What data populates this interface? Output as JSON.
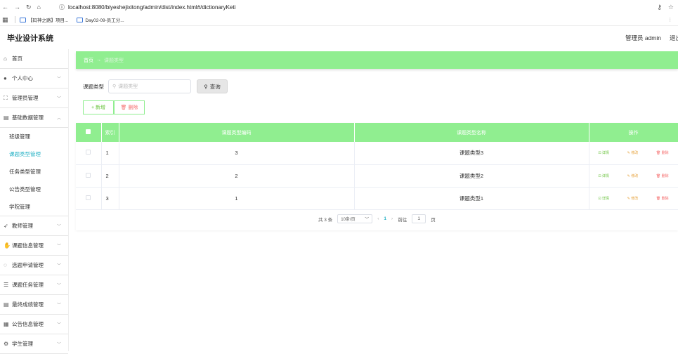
{
  "browser": {
    "url": "localhost:8080/biyeshejixitong/admin/dist/index.html#/dictionaryKeti",
    "bookmarks": [
      "【码神之路】项目...",
      "Day02-09-员工分..."
    ]
  },
  "header": {
    "title": "毕业设计系统",
    "user": "管理员 admin",
    "logout": "退出"
  },
  "sidebar": {
    "items": [
      {
        "label": "首页",
        "icon": "home-icon"
      },
      {
        "label": "个人中心",
        "icon": "person-icon"
      },
      {
        "label": "管理员管理",
        "icon": "frame-icon"
      },
      {
        "label": "基础数据管理",
        "icon": "trash-icon"
      }
    ],
    "subitems": [
      "班级管理",
      "课题类型管理",
      "任务类型管理",
      "公告类型管理",
      "学院管理"
    ],
    "items_after": [
      {
        "label": "教师管理",
        "icon": "send-icon"
      },
      {
        "label": "课题信息管理",
        "icon": "thumb-icon"
      },
      {
        "label": "选题申请管理",
        "icon": "power-icon"
      },
      {
        "label": "课题任务管理",
        "icon": "sliders-icon"
      },
      {
        "label": "最终成绩管理",
        "icon": "trash-icon"
      },
      {
        "label": "公告信息管理",
        "icon": "grid-icon"
      },
      {
        "label": "学生管理",
        "icon": "gear-icon"
      }
    ]
  },
  "breadcrumb": {
    "home": "首页",
    "current": "课题类型"
  },
  "search": {
    "label": "课题类型",
    "placeholder": "课题类型",
    "button": "查询"
  },
  "actions": {
    "add": "新增",
    "delete": "删除"
  },
  "table": {
    "headers": [
      "索引",
      "课题类型编码",
      "课题类型名称",
      "操作"
    ],
    "rows": [
      {
        "index": "1",
        "code": "3",
        "name": "课题类型3"
      },
      {
        "index": "2",
        "code": "2",
        "name": "课题类型2"
      },
      {
        "index": "3",
        "code": "1",
        "name": "课题类型1"
      }
    ],
    "ops": {
      "view": "详情",
      "edit": "修改",
      "delete": "删除"
    }
  },
  "pager": {
    "total": "共 3 条",
    "size": "10条/页",
    "current": "1",
    "goto_label": "前往",
    "goto_value": "1",
    "page_unit": "页"
  }
}
